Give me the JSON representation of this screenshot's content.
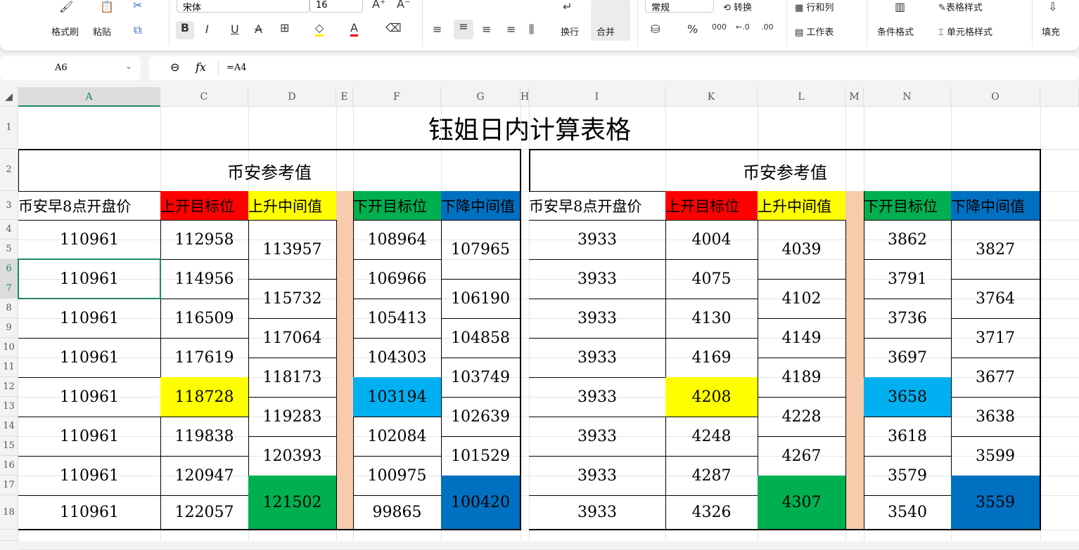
{
  "ribbon": {
    "format_painter": "格式刷",
    "paste": "粘贴",
    "font_name": "宋体",
    "font_size": "16",
    "wrap": "换行",
    "merge": "合并",
    "number_format": "常规",
    "convert": "转换",
    "rows_cols": "行和列",
    "worksheet": "工作表",
    "cond_format": "条件格式",
    "table_style": "表格样式",
    "cell_style": "单元格样式",
    "fill": "填充"
  },
  "formula_bar": {
    "name_box": "A6",
    "formula": "=A4",
    "fx": "fx"
  },
  "columns": [
    "A",
    "C",
    "D",
    "E",
    "F",
    "G",
    "H",
    "I",
    "K",
    "L",
    "M",
    "N",
    "O"
  ],
  "rows": [
    "1",
    "2",
    "3",
    "4",
    "5",
    "6",
    "7",
    "8",
    "9",
    "10",
    "11",
    "12",
    "13",
    "14",
    "15",
    "16",
    "17",
    "18"
  ],
  "sheet": {
    "title": "钰姐日内计算表格",
    "left": {
      "section": "币安参考值",
      "headers": [
        "币安早8点开盘价",
        "上开目标位",
        "上升中间值",
        "下开目标位",
        "下降中间值"
      ],
      "open": [
        "110961",
        "110961",
        "110961",
        "110961",
        "110961",
        "110961",
        "110961",
        "110961"
      ],
      "up_target": [
        "112958",
        "114956",
        "116509",
        "117619",
        "118728",
        "119838",
        "120947",
        "122057"
      ],
      "up_mid": [
        "113957",
        "115732",
        "117064",
        "118173",
        "119283",
        "120393",
        "121502"
      ],
      "down_target": [
        "108964",
        "106966",
        "105413",
        "104303",
        "103194",
        "102084",
        "100975",
        "99865"
      ],
      "down_mid": [
        "107965",
        "106190",
        "104858",
        "103749",
        "102639",
        "101529",
        "100420"
      ]
    },
    "right": {
      "section": "币安参考值",
      "headers": [
        "币安早8点开盘价",
        "上开目标位",
        "上升中间值",
        "下开目标位",
        "下降中间值"
      ],
      "open": [
        "3933",
        "3933",
        "3933",
        "3933",
        "3933",
        "3933",
        "3933",
        "3933"
      ],
      "up_target": [
        "4004",
        "4075",
        "4130",
        "4169",
        "4208",
        "4248",
        "4287",
        "4326"
      ],
      "up_mid": [
        "4039",
        "4102",
        "4149",
        "4189",
        "4228",
        "4267",
        "4307"
      ],
      "down_target": [
        "3862",
        "3791",
        "3736",
        "3697",
        "3658",
        "3618",
        "3579",
        "3540"
      ],
      "down_mid": [
        "3827",
        "3764",
        "3717",
        "3677",
        "3638",
        "3599",
        "3559"
      ]
    }
  },
  "colors": {
    "red": "#ff0000",
    "yellow": "#ffff00",
    "green": "#00b050",
    "blue": "#0070c0",
    "cyan": "#00b0f0",
    "peach": "#f8cbad",
    "selection": "#1e8a5a"
  }
}
